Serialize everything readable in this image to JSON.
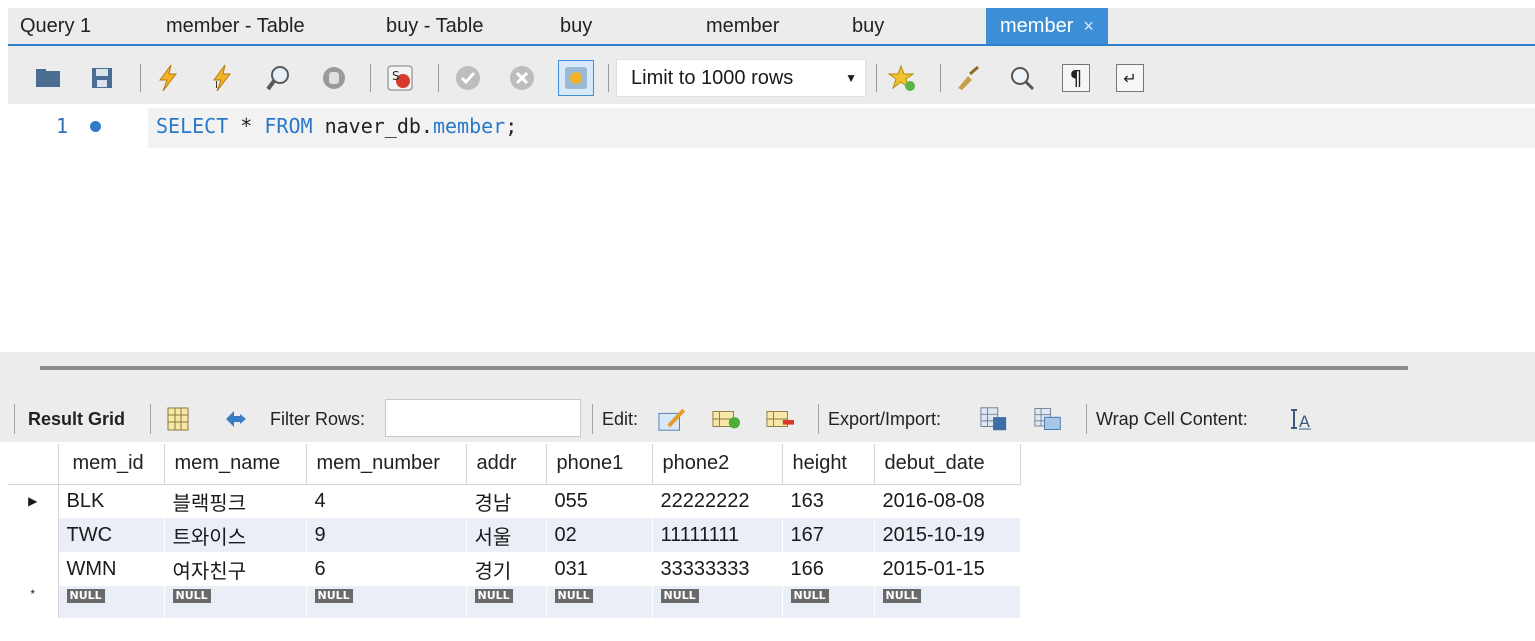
{
  "tabs": [
    {
      "label": "Query 1"
    },
    {
      "label": "member - Table"
    },
    {
      "label": "buy - Table"
    },
    {
      "label": "buy"
    },
    {
      "label": "member"
    },
    {
      "label": "buy"
    },
    {
      "label": "member",
      "active": true
    }
  ],
  "tab_close_glyph": "×",
  "toolbar": {
    "icons": [
      "open-folder-icon",
      "save-icon",
      "execute-icon",
      "execute-current-icon",
      "explain-icon",
      "stop-icon",
      "toggle-error-icon",
      "commit-icon",
      "rollback-icon",
      "autocommit-icon",
      "bookmark-star-icon",
      "beautify-icon",
      "find-icon",
      "invisibles-icon",
      "wrap-icon"
    ],
    "limit_label": "Limit to 1000 rows"
  },
  "editor": {
    "line_number": "1",
    "sql_keyword_select": "SELECT",
    "sql_star": " * ",
    "sql_keyword_from": "FROM",
    "sql_schema": " naver_db.",
    "sql_table": "member",
    "sql_end": ";"
  },
  "result_toolbar": {
    "result_grid_label": "Result Grid",
    "filter_label": "Filter Rows:",
    "filter_value": "",
    "edit_label": "Edit:",
    "export_label": "Export/Import:",
    "wrap_label": "Wrap Cell Content:"
  },
  "grid": {
    "columns": [
      "mem_id",
      "mem_name",
      "mem_number",
      "addr",
      "phone1",
      "phone2",
      "height",
      "debut_date"
    ],
    "rows": [
      [
        "BLK",
        "블랙핑크",
        "4",
        "경남",
        "055",
        "22222222",
        "163",
        "2016-08-08"
      ],
      [
        "TWC",
        "트와이스",
        "9",
        "서울",
        "02",
        "11111111",
        "167",
        "2015-10-19"
      ],
      [
        "WMN",
        "여자친구",
        "6",
        "경기",
        "031",
        "33333333",
        "166",
        "2015-01-15"
      ]
    ],
    "null_label": "NULL",
    "current_row_marker": "▶",
    "new_row_marker": "*"
  },
  "colors": {
    "active_tab": "#3c8fd6",
    "keyword": "#2a79c9",
    "alt_row": "#e9eef7"
  }
}
